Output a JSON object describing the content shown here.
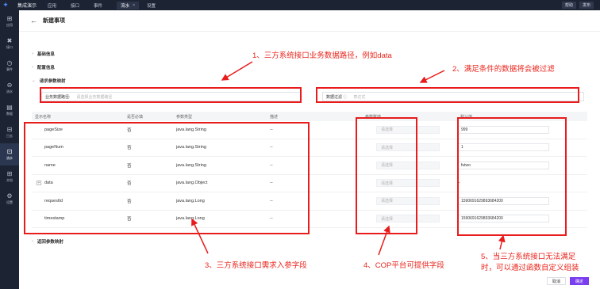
{
  "topbar": {
    "title": "集成演示",
    "nav": [
      "应用",
      "接口",
      "事件"
    ],
    "active_tab": "流水",
    "tab_close": "×",
    "extra_nav": "设置",
    "right_buttons": [
      "帮助",
      "发布"
    ]
  },
  "sidebar": {
    "items": [
      {
        "icon": "⊞",
        "label": "应用"
      },
      {
        "icon": "✖",
        "label": "接口"
      },
      {
        "icon": "◷",
        "label": "事件"
      },
      {
        "icon": "⊖",
        "label": "流水"
      },
      {
        "icon": "▤",
        "label": "数据"
      },
      {
        "icon": "⊟",
        "label": "日志"
      },
      {
        "icon": "⊡",
        "label": "流水"
      },
      {
        "icon": "⊞",
        "label": "文档"
      },
      {
        "icon": "⚙",
        "label": "设置"
      }
    ],
    "active_index": 6
  },
  "header": {
    "back": "←",
    "title": "新建事项"
  },
  "sections": {
    "basic": "基础信息",
    "config": "配置信息",
    "request": "请求参数映射",
    "response": "返回参数映射"
  },
  "fields": {
    "path_label": "业务数据路径:",
    "path_placeholder": "请选择业务数据路径",
    "filter_label": "数据过滤",
    "filter_placeholder": "表达式"
  },
  "table": {
    "headers": [
      "显示名称",
      "是否必填",
      "参数类型",
      "描述",
      "参数赋值",
      "默认值"
    ],
    "rows": [
      {
        "name": "pageSize",
        "required": "否",
        "type": "java.lang.String",
        "desc": "--",
        "assign": "请选择",
        "default": "999"
      },
      {
        "name": "pageNum",
        "required": "否",
        "type": "java.lang.String",
        "desc": "--",
        "assign": "请选择",
        "default": "1"
      },
      {
        "name": "name",
        "required": "否",
        "type": "java.lang.String",
        "desc": "--",
        "assign": "请选择",
        "default": "futwo"
      },
      {
        "name": "data",
        "required": "否",
        "type": "java.lang.Object",
        "desc": "--",
        "assign": "请选择",
        "default": "--"
      },
      {
        "name": "requestId",
        "required": "否",
        "type": "java.lang.Long",
        "desc": "--",
        "assign": "请选择",
        "default": "1590691629893684200"
      },
      {
        "name": "timestamp",
        "required": "否",
        "type": "java.lang.Long",
        "desc": "--",
        "assign": "请选择",
        "default": "1590691629893684200"
      }
    ]
  },
  "annotations": {
    "a1": "1、三方系统接口业务数据路径，例如data",
    "a2": "2、满足条件的数据将会被过滤",
    "a3": "3、三方系统接口需求入参字段",
    "a4": "4、COP平台可提供字段",
    "a5_line1": "5、当三方系统接口无法满足",
    "a5_line2": "时，可以通过函数自定义组装"
  },
  "footer": {
    "cancel": "取消",
    "ok": "确定"
  },
  "colors": {
    "annotation_red": "#e81c1c",
    "primary": "#7a3df0",
    "sidebar_bg": "#1c2333"
  }
}
